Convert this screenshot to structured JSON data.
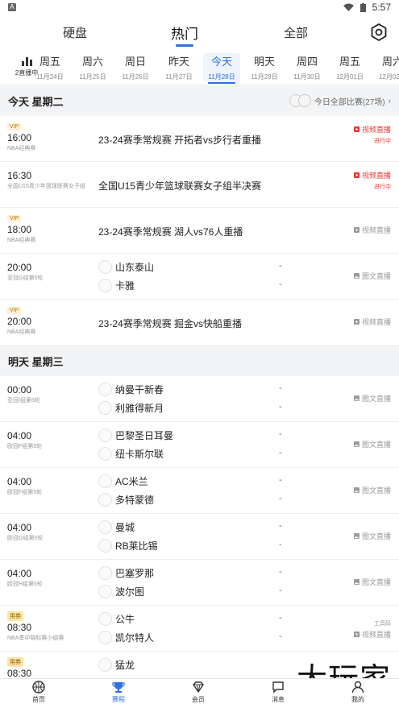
{
  "statusbar": {
    "time": "5:57"
  },
  "topnav": {
    "tabs": [
      "硬盘",
      "热门",
      "全部"
    ],
    "active": 1
  },
  "datebar": {
    "live_label": "2直播中",
    "days": [
      {
        "wd": "周五",
        "dt": "11月24日"
      },
      {
        "wd": "周六",
        "dt": "11月25日"
      },
      {
        "wd": "周日",
        "dt": "11月26日"
      },
      {
        "wd": "昨天",
        "dt": "11月27日"
      },
      {
        "wd": "今天",
        "dt": "11月28日"
      },
      {
        "wd": "明天",
        "dt": "11月29日"
      },
      {
        "wd": "周四",
        "dt": "11月30日"
      },
      {
        "wd": "周五",
        "dt": "12月01日"
      },
      {
        "wd": "周六",
        "dt": "12月02日"
      }
    ]
  },
  "sections": [
    {
      "title": "今天 星期二",
      "all_label": "今日全部比赛(27场)",
      "rows": [
        {
          "tag": "VIP",
          "time": "16:00",
          "league": "NBA经典赛",
          "title": "23-24赛季常规赛 开拓者vs步行者重播",
          "status": "视频直播",
          "sub": "进行中",
          "live": true
        },
        {
          "tag": "",
          "time": "16:30",
          "league": "全国U15青少年篮球联赛女子组",
          "title": "全国U15青少年篮球联赛女子组半决赛",
          "status": "视频直播",
          "sub": "进行中",
          "live": true
        },
        {
          "tag": "VIP",
          "time": "18:00",
          "league": "NBA经典赛",
          "title": "23-24赛季常规赛 湖人vs76人重播",
          "status": "视频直播",
          "sub": "",
          "live": false
        },
        {
          "tag": "",
          "time": "20:00",
          "league": "亚冠G组第5轮",
          "home": "山东泰山",
          "away": "卡雅",
          "score": "-",
          "status": "图文直播",
          "sub": "",
          "live": false
        },
        {
          "tag": "VIP",
          "time": "20:00",
          "league": "NBA经典赛",
          "title": "23-24赛季常规赛 掘金vs快船重播",
          "status": "视频直播",
          "sub": "",
          "live": false
        }
      ]
    },
    {
      "title": "明天 星期三",
      "all_label": "",
      "rows": [
        {
          "tag": "",
          "time": "00:00",
          "league": "亚冠I组第5轮",
          "home": "纳曼干新春",
          "away": "利雅得新月",
          "score": "-",
          "status": "图文直播",
          "sub": "",
          "live": false
        },
        {
          "tag": "",
          "time": "04:00",
          "league": "欧冠F组第5轮",
          "home": "巴黎圣日耳曼",
          "away": "纽卡斯尔联",
          "score": "-",
          "status": "图文直播",
          "sub": "",
          "live": false
        },
        {
          "tag": "",
          "time": "04:00",
          "league": "欧冠F组第5轮",
          "home": "AC米兰",
          "away": "多特蒙德",
          "score": "-",
          "status": "图文直播",
          "sub": "",
          "live": false
        },
        {
          "tag": "",
          "time": "04:00",
          "league": "欧冠G组第5轮",
          "home": "曼城",
          "away": "RB莱比锡",
          "score": "-",
          "status": "图文直播",
          "sub": "",
          "live": false
        },
        {
          "tag": "",
          "time": "04:00",
          "league": "欧冠H组第5轮",
          "home": "巴塞罗那",
          "away": "波尔图",
          "score": "-",
          "status": "图文直播",
          "sub": "",
          "live": false
        },
        {
          "tag": "用券",
          "time": "08:30",
          "league": "NBA季中锦标赛小组赛",
          "home": "公牛",
          "away": "凯尔特人",
          "score": "-",
          "status": "视频直播",
          "sub_top": "工具码",
          "live": false
        },
        {
          "tag": "用券",
          "time": "08:30",
          "league": "",
          "home": "猛龙",
          "away": "",
          "score": "",
          "status": "",
          "live": false
        }
      ]
    }
  ],
  "tabbar": [
    "首页",
    "赛程",
    "会员",
    "消息",
    "我的"
  ],
  "tabbar_active": 1,
  "watermark": "大玩家"
}
